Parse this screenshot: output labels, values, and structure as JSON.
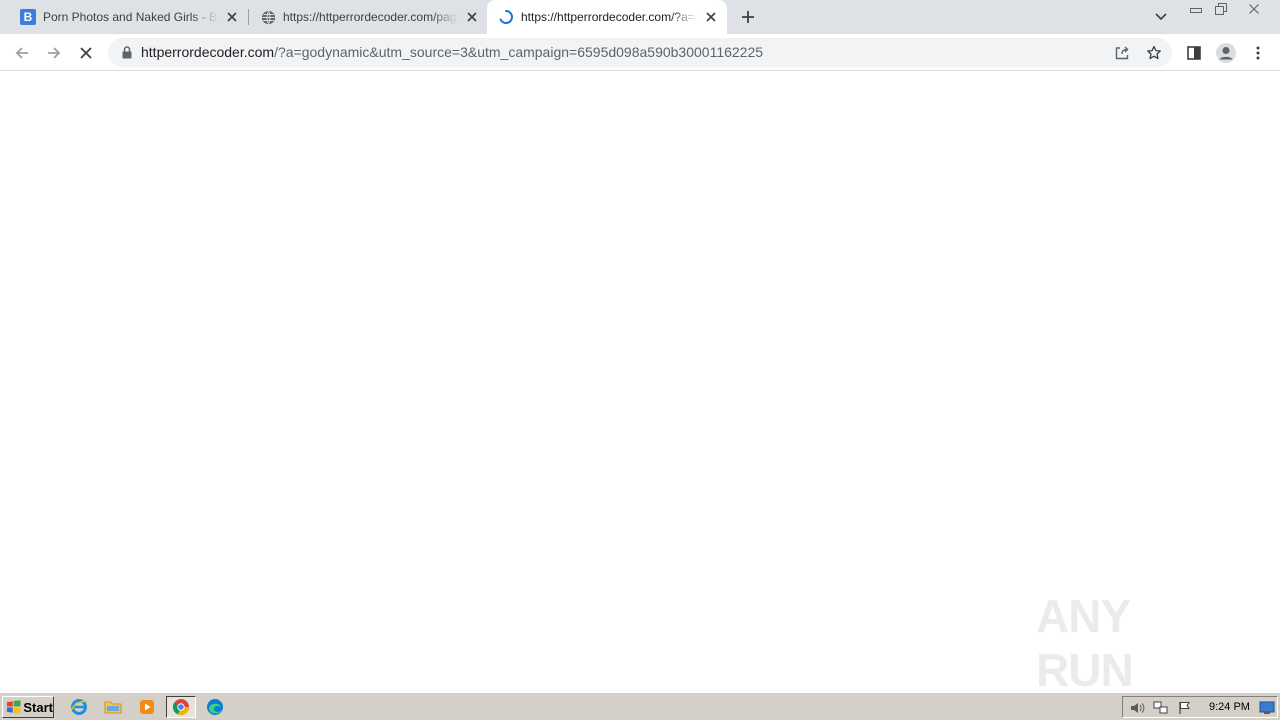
{
  "browser": {
    "tabs": [
      {
        "title": "Porn Photos and Naked Girls - Boomba",
        "favicon": "letter-b-favicon",
        "favicon_letter": "B",
        "active": false
      },
      {
        "title": "https://httperrordecoder.com/page/",
        "favicon": "globe-icon",
        "active": false
      },
      {
        "title": "https://httperrordecoder.com/?a=godynamic",
        "favicon": "loading-spinner-icon",
        "active": true
      }
    ],
    "new_tab_label": "+",
    "omnibox": {
      "domain": "httperrordecoder.com",
      "path": "/?a=godynamic&utm_source=3&utm_campaign=6595d098a590b30001162225"
    },
    "colors": {
      "tabstrip": "#dee1e6",
      "omnibox": "#f1f3f4",
      "accent": "#1a73e8"
    }
  },
  "watermark": {
    "text": "ANY RUN"
  },
  "taskbar": {
    "start_label": "Start",
    "pinned": [
      "internet-explorer-icon",
      "file-explorer-icon",
      "media-player-icon",
      "chrome-icon",
      "edge-icon"
    ],
    "clock": "9:24 PM"
  }
}
